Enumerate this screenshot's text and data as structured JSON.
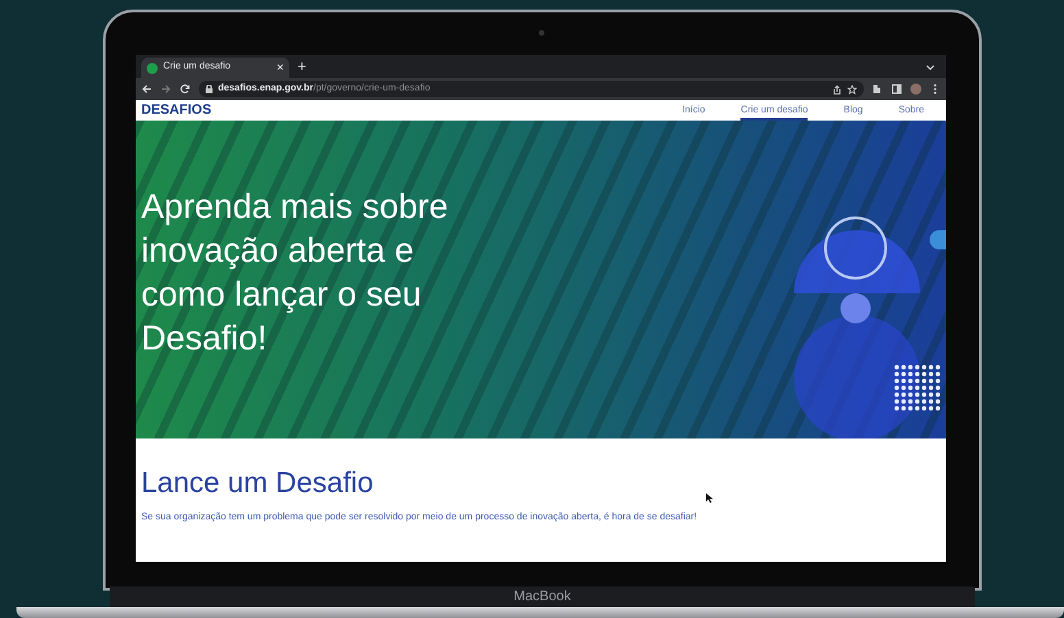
{
  "device": {
    "label": "MacBook"
  },
  "browser": {
    "tab": {
      "title": "Crie um desafio",
      "selected": true
    },
    "close": "×",
    "new_tab": "+",
    "url_host": "desafios.enap.gov.br",
    "url_path": "/pt/governo/crie-um-desafio"
  },
  "site": {
    "logo": "DESAFIOS",
    "nav": [
      {
        "label": "Início",
        "selected": false
      },
      {
        "label": "Crie um desafio",
        "selected": true
      },
      {
        "label": "Blog",
        "selected": false
      },
      {
        "label": "Sobre",
        "selected": false
      }
    ]
  },
  "hero": {
    "headline": "Aprenda mais sobre inovação aberta e como lançar o seu Desafio!"
  },
  "section": {
    "title": "Lance um Desafio",
    "text": "Se sua organização tem um problema que pode ser resolvido por meio de um processo de inovação aberta, é hora de se desafiar!"
  }
}
